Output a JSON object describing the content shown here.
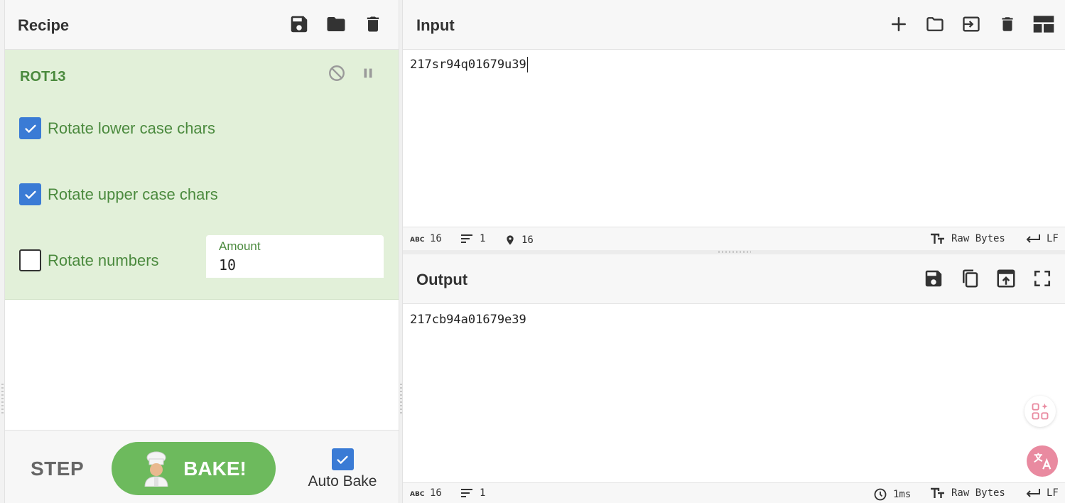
{
  "recipe": {
    "title": "Recipe",
    "operation": {
      "name": "ROT13",
      "options": [
        {
          "label": "Rotate lower case chars",
          "checked": true
        },
        {
          "label": "Rotate upper case chars",
          "checked": true
        },
        {
          "label": "Rotate numbers",
          "checked": false
        }
      ],
      "amount": {
        "label": "Amount",
        "value": "10"
      }
    },
    "controls": {
      "step_label": "STEP",
      "bake_label": "BAKE!",
      "auto_bake_label": "Auto Bake",
      "auto_bake_checked": true
    }
  },
  "input": {
    "title": "Input",
    "text": "217sr94q01679u39",
    "status": {
      "length": "16",
      "lines": "1",
      "position": "16",
      "encoding": "Raw Bytes",
      "eol": "LF"
    }
  },
  "output": {
    "title": "Output",
    "text": "217cb94a01679e39",
    "status": {
      "length": "16",
      "lines": "1",
      "time": "1ms",
      "encoding": "Raw Bytes",
      "eol": "LF"
    }
  },
  "colors": {
    "operation_bg": "#e2f0d9",
    "operation_text": "#4b8a3e",
    "bake_button": "#6dba5d",
    "checkbox": "#3a7bd5"
  }
}
